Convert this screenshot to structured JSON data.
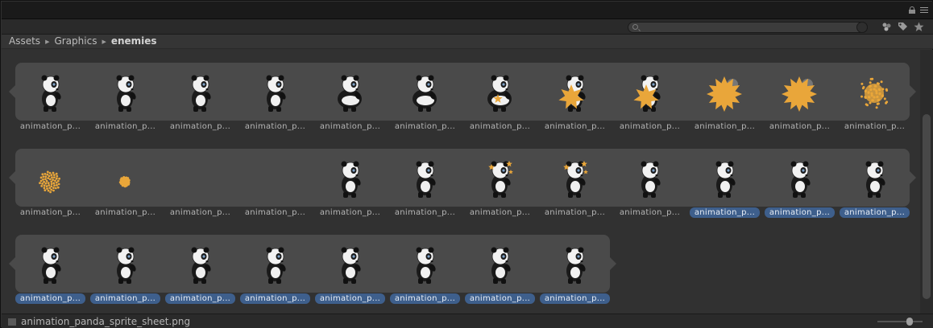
{
  "breadcrumb": {
    "items": [
      "Assets",
      "Graphics"
    ],
    "current": "enemies"
  },
  "search": {
    "value": "",
    "placeholder": ""
  },
  "icons": {
    "lock": "lock-icon",
    "menu": "menu-icon",
    "search": "search-icon",
    "filter_type": "filter-by-type-icon",
    "filter_label": "filter-by-label-icon",
    "favorite": "star-icon",
    "file": "image-file-icon"
  },
  "colors": {
    "background": "#313131",
    "group": "#4a4a4a",
    "selection": "#3e5f8c",
    "star_burst": "#e9a63a"
  },
  "groups": [
    {
      "frames": [
        {
          "label": "animation_p...",
          "selected": false,
          "sprite": "panda-walk"
        },
        {
          "label": "animation_p...",
          "selected": false,
          "sprite": "panda-walk"
        },
        {
          "label": "animation_p...",
          "selected": false,
          "sprite": "panda-walk"
        },
        {
          "label": "animation_p...",
          "selected": false,
          "sprite": "panda-walk"
        },
        {
          "label": "animation_p...",
          "selected": false,
          "sprite": "panda-grow"
        },
        {
          "label": "animation_p...",
          "selected": false,
          "sprite": "panda-round"
        },
        {
          "label": "animation_p...",
          "selected": false,
          "sprite": "panda-hit"
        },
        {
          "label": "animation_p...",
          "selected": false,
          "sprite": "panda-burst"
        },
        {
          "label": "animation_p...",
          "selected": false,
          "sprite": "panda-burst"
        },
        {
          "label": "animation_p...",
          "selected": false,
          "sprite": "burst-large"
        },
        {
          "label": "animation_p...",
          "selected": false,
          "sprite": "burst-large"
        },
        {
          "label": "animation_p...",
          "selected": false,
          "sprite": "burst-particles"
        }
      ]
    },
    {
      "frames": [
        {
          "label": "animation_p...",
          "selected": false,
          "sprite": "particles-medium"
        },
        {
          "label": "animation_p...",
          "selected": false,
          "sprite": "particles-small"
        },
        {
          "label": "animation_p...",
          "selected": false,
          "sprite": "empty"
        },
        {
          "label": "animation_p...",
          "selected": false,
          "sprite": "empty"
        },
        {
          "label": "animation_p...",
          "selected": false,
          "sprite": "panda-walk"
        },
        {
          "label": "animation_p...",
          "selected": false,
          "sprite": "panda-walk"
        },
        {
          "label": "animation_p...",
          "selected": false,
          "sprite": "panda-stars"
        },
        {
          "label": "animation_p...",
          "selected": false,
          "sprite": "panda-stars"
        },
        {
          "label": "animation_p...",
          "selected": false,
          "sprite": "panda-walk"
        },
        {
          "label": "animation_p...",
          "selected": true,
          "sprite": "panda-walk"
        },
        {
          "label": "animation_p...",
          "selected": true,
          "sprite": "panda-walk"
        },
        {
          "label": "animation_p...",
          "selected": true,
          "sprite": "panda-walk"
        }
      ]
    },
    {
      "frames": [
        {
          "label": "animation_p...",
          "selected": true,
          "sprite": "panda-walk"
        },
        {
          "label": "animation_p...",
          "selected": true,
          "sprite": "panda-walk"
        },
        {
          "label": "animation_p...",
          "selected": true,
          "sprite": "panda-walk"
        },
        {
          "label": "animation_p...",
          "selected": true,
          "sprite": "panda-walk"
        },
        {
          "label": "animation_p...",
          "selected": true,
          "sprite": "panda-walk"
        },
        {
          "label": "animation_p...",
          "selected": true,
          "sprite": "panda-walk"
        },
        {
          "label": "animation_p...",
          "selected": true,
          "sprite": "panda-walk"
        },
        {
          "label": "animation_p...",
          "selected": true,
          "sprite": "panda-walk"
        }
      ]
    }
  ],
  "status": {
    "filename": "animation_panda_sprite_sheet.png"
  }
}
